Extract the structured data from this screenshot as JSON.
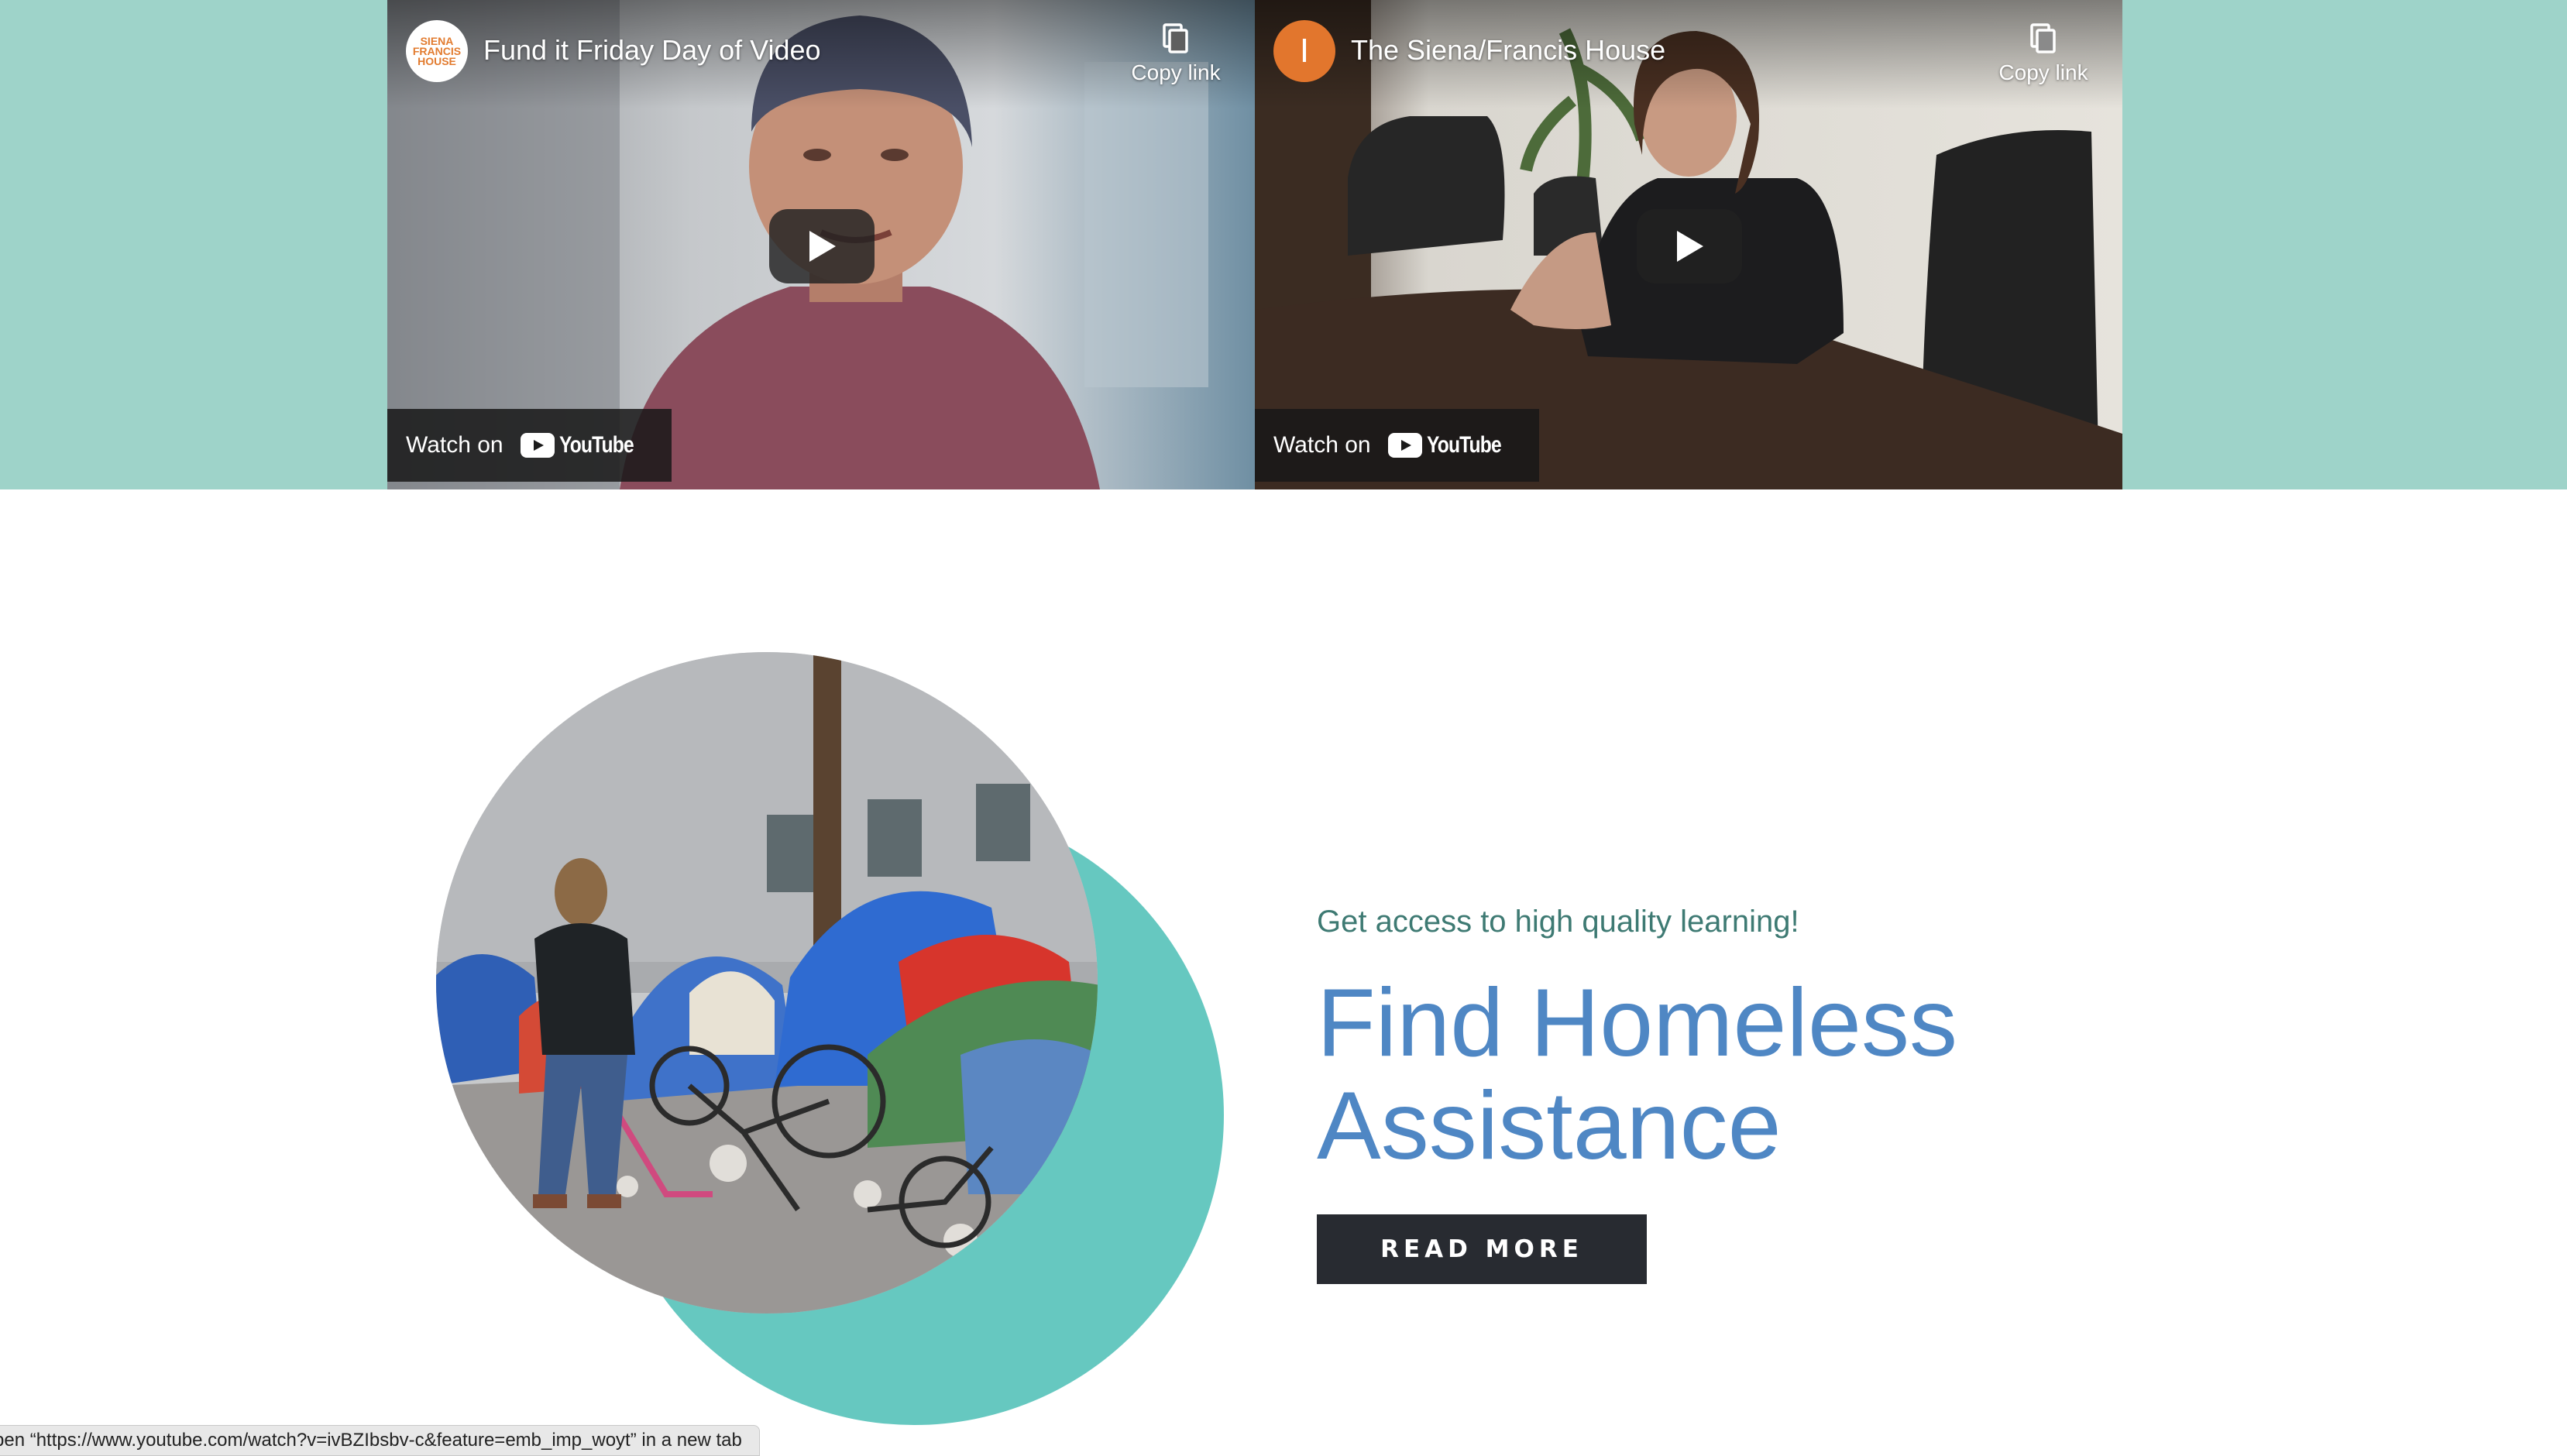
{
  "videos": [
    {
      "channel_avatar_text": "SIENA FRANCIS HOUSE",
      "title": "Fund it Friday Day of Video",
      "copy_link_label": "Copy link",
      "watch_on_label": "Watch on",
      "youtube_label": "YouTube"
    },
    {
      "channel_avatar_text": "I",
      "title": "The Siena/Francis House",
      "copy_link_label": "Copy link",
      "watch_on_label": "Watch on",
      "youtube_label": "YouTube"
    }
  ],
  "feature": {
    "tagline": "Get access to high quality learning!",
    "heading": "Find Homeless Assistance",
    "button_label": "READ MORE"
  },
  "status_bar": {
    "text": "pen “https://www.youtube.com/watch?v=ivBZIbsbv-c&feature=emb_imp_woyt” in a new tab"
  },
  "colors": {
    "band": "#9ed3c9",
    "accent_circle": "#66c8c0",
    "heading": "#4f87c4",
    "tagline": "#3e7a73",
    "button": "#282b31",
    "youtube_red": "#ff0000",
    "avatar_orange": "#e2762d"
  }
}
